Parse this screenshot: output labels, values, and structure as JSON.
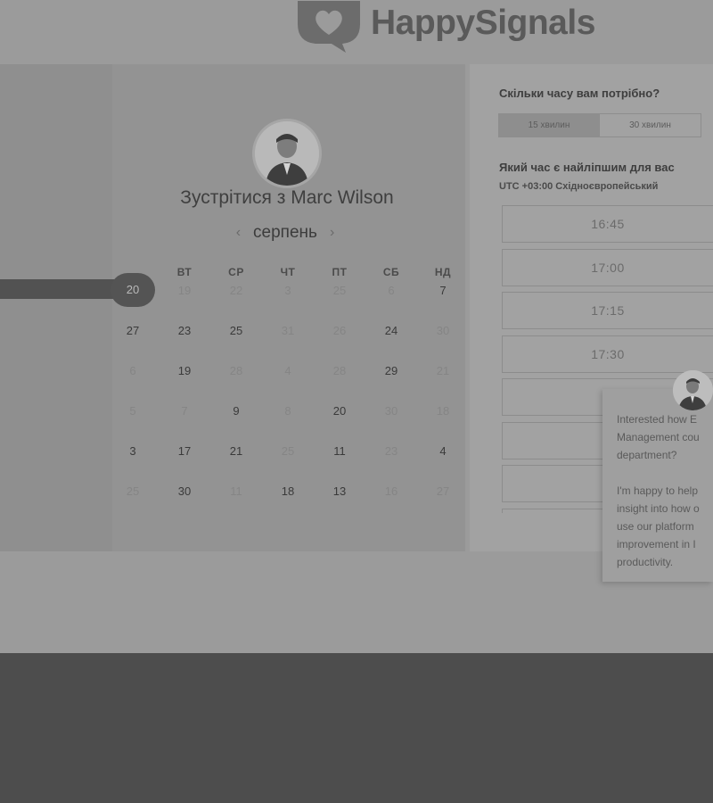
{
  "brand": {
    "name": "HappySignals"
  },
  "calendar": {
    "title": "Зустрітися з Marc Wilson",
    "month": "серпень",
    "prev_icon": "chevron-left-icon",
    "next_icon": "chevron-right-icon",
    "weekdays": [
      "ВТ",
      "СР",
      "ЧТ",
      "ПТ",
      "СБ",
      "НД"
    ],
    "selected_day": "20",
    "rows": [
      [
        {
          "d": "",
          "s": "off"
        },
        {
          "d": "19",
          "s": "off"
        },
        {
          "d": "22",
          "s": "off"
        },
        {
          "d": "3",
          "s": "off"
        },
        {
          "d": "25",
          "s": "off"
        },
        {
          "d": "6",
          "s": "off"
        },
        {
          "d": "7",
          "s": "on"
        }
      ],
      [
        {
          "d": "27",
          "s": "on"
        },
        {
          "d": "23",
          "s": "on"
        },
        {
          "d": "25",
          "s": "on"
        },
        {
          "d": "31",
          "s": "off"
        },
        {
          "d": "26",
          "s": "off"
        },
        {
          "d": "24",
          "s": "on"
        },
        {
          "d": "30",
          "s": "off"
        }
      ],
      [
        {
          "d": "6",
          "s": "off"
        },
        {
          "d": "19",
          "s": "on"
        },
        {
          "d": "28",
          "s": "off"
        },
        {
          "d": "4",
          "s": "off"
        },
        {
          "d": "28",
          "s": "off"
        },
        {
          "d": "29",
          "s": "on"
        },
        {
          "d": "21",
          "s": "off"
        }
      ],
      [
        {
          "d": "5",
          "s": "off"
        },
        {
          "d": "7",
          "s": "off"
        },
        {
          "d": "9",
          "s": "on"
        },
        {
          "d": "8",
          "s": "off"
        },
        {
          "d": "20",
          "s": "on"
        },
        {
          "d": "30",
          "s": "off"
        },
        {
          "d": "18",
          "s": "off"
        }
      ],
      [
        {
          "d": "3",
          "s": "on"
        },
        {
          "d": "17",
          "s": "on"
        },
        {
          "d": "21",
          "s": "on"
        },
        {
          "d": "25",
          "s": "off"
        },
        {
          "d": "11",
          "s": "on"
        },
        {
          "d": "23",
          "s": "off"
        },
        {
          "d": "4",
          "s": "on"
        }
      ],
      [
        {
          "d": "25",
          "s": "off"
        },
        {
          "d": "30",
          "s": "on"
        },
        {
          "d": "11",
          "s": "off"
        },
        {
          "d": "18",
          "s": "on"
        },
        {
          "d": "13",
          "s": "on"
        },
        {
          "d": "16",
          "s": "off"
        },
        {
          "d": "27",
          "s": "off"
        }
      ]
    ]
  },
  "booking": {
    "duration_question": "Скільки часу вам потрібно?",
    "durations": [
      "15 хвилин",
      "30 хвилин"
    ],
    "active_duration": "15 хвилин",
    "time_question": "Який час є найліпшим для вас",
    "timezone": "UTC +03:00 Східноєвропейський",
    "slots": [
      "16:45",
      "17:00",
      "17:15",
      "17:30",
      "",
      "",
      "",
      ""
    ]
  },
  "chat": {
    "messages": [
      [
        "Interested how E",
        "Management cou",
        "department?"
      ],
      [
        "I'm happy to help",
        "insight into how o",
        "use our platform",
        "improvement in I",
        "productivity."
      ]
    ]
  },
  "colors": {
    "overlay_bg": "#9b9b9b",
    "dark_band": "#4d4d4d",
    "selected_day": "#545454"
  }
}
